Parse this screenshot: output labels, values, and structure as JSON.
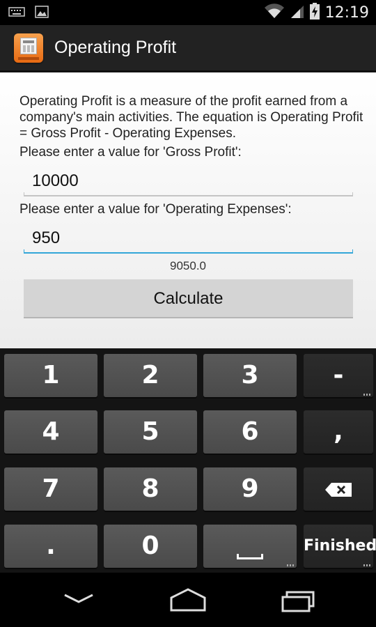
{
  "status_bar": {
    "time": "12:19",
    "icons": [
      "keyboard-icon",
      "image-icon",
      "wifi-icon",
      "signal-icon",
      "battery-charging-icon"
    ]
  },
  "action_bar": {
    "title": "Operating Profit",
    "app_icon": "calculator-app-icon"
  },
  "form": {
    "description": "Operating Profit is a measure of the profit earned from a company's main activities. The equation is Operating Profit = Gross Profit - Operating Expenses.",
    "gross_profit_prompt": "Please enter a value for 'Gross Profit':",
    "gross_profit_value": "10000",
    "operating_expenses_prompt": "Please enter a value for 'Operating Expenses':",
    "operating_expenses_value": "950",
    "result": "9050.0",
    "calculate_label": "Calculate"
  },
  "keyboard": {
    "keys": {
      "k1": "1",
      "k2": "2",
      "k3": "3",
      "minus": "-",
      "k4": "4",
      "k5": "5",
      "k6": "6",
      "comma": ",",
      "k7": "7",
      "k8": "8",
      "k9": "9",
      "dot": ".",
      "k0": "0",
      "finished": "Finished"
    },
    "icons": [
      "backspace-icon",
      "space-icon"
    ]
  },
  "nav_bar": {
    "icons": [
      "back-icon",
      "home-icon",
      "recent-apps-icon"
    ]
  },
  "colors": {
    "focus_underline": "#33a6d8",
    "app_icon": "#e86a12",
    "key_background": "#4f4f4f"
  }
}
